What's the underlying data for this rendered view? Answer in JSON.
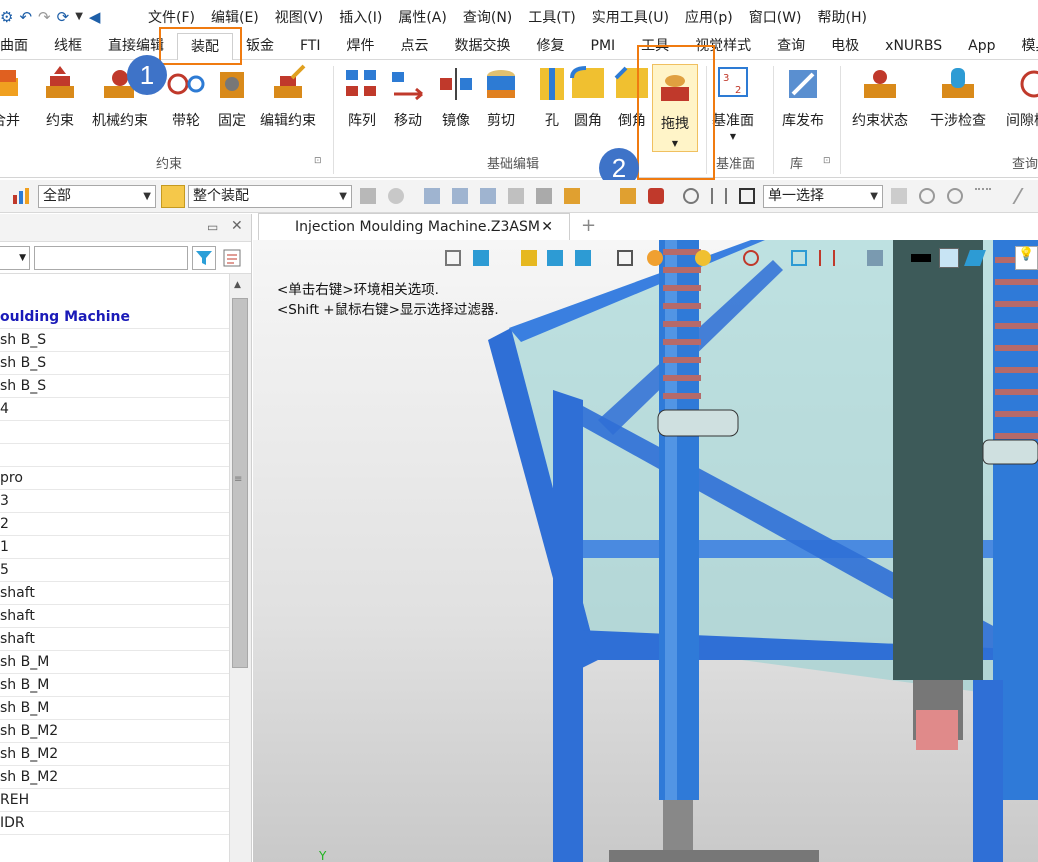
{
  "menu": [
    "文件(F)",
    "编辑(E)",
    "视图(V)",
    "插入(I)",
    "属性(A)",
    "查询(N)",
    "工具(T)",
    "实用工具(U)",
    "应用(p)",
    "窗口(W)",
    "帮助(H)"
  ],
  "tabs": [
    "曲面",
    "线框",
    "直接编辑",
    "装配",
    "钣金",
    "FTI",
    "焊件",
    "点云",
    "数据交换",
    "修复",
    "PMI",
    "工具",
    "视觉样式",
    "查询",
    "电极",
    "xNURBS",
    "App",
    "模具"
  ],
  "active_tab": "装配",
  "ribbon": {
    "buttons": [
      "合并",
      "约束",
      "机械约束",
      "带轮",
      "固定",
      "编辑约束",
      "阵列",
      "移动",
      "镜像",
      "剪切",
      "孔",
      "圆角",
      "倒角",
      "拖拽",
      "基准面",
      "库发布",
      "约束状态",
      "干涉检查",
      "间隙检查"
    ],
    "groups": [
      "约束",
      "基础编辑",
      "基准面",
      "库",
      "查询"
    ]
  },
  "toolbar": {
    "filter_value": "全部",
    "scope_value": "整个装配",
    "select_mode": "单一选择"
  },
  "document": {
    "tab_title": "Injection Moulding  Machine.Z3ASM"
  },
  "tree": {
    "root": "oulding  Machine",
    "rows": [
      "",
      "sh B_S",
      "sh B_S",
      "sh B_S",
      "4",
      "",
      "",
      "pro",
      "3",
      "2",
      "1",
      "5",
      "shaft",
      "shaft",
      "shaft",
      "sh B_M",
      "sh B_M",
      "sh B_M",
      "sh B_M2",
      "sh B_M2",
      "sh B_M2",
      "REH",
      "IDR"
    ]
  },
  "viewport_hints": [
    "<单击右键>环境相关选项.",
    "<Shift +鼠标右键>显示选择过滤器."
  ],
  "badges": [
    "1",
    "2"
  ],
  "colors": {
    "accent": "#f07b10",
    "badge": "#3e73c8",
    "steel": "#2f6fd6",
    "glass": "#8fd0cf",
    "spring": "#b56a6a"
  }
}
